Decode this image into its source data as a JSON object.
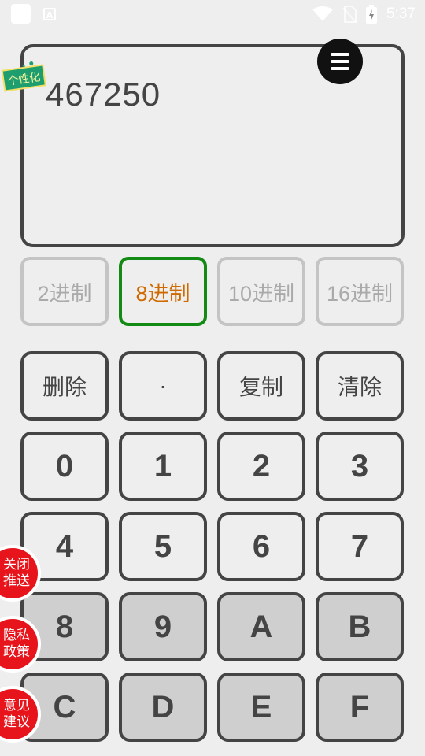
{
  "status_bar": {
    "time": "5:37",
    "icons": [
      "app-square-icon",
      "a-icon",
      "wifi-icon",
      "no-sim-icon",
      "battery-charging-icon"
    ]
  },
  "display": {
    "value": "467250",
    "badge_text": "个性化",
    "menu_icon": "menu-icon"
  },
  "bases": [
    {
      "label": "2进制",
      "active": false
    },
    {
      "label": "8进制",
      "active": true
    },
    {
      "label": "10进制",
      "active": false
    },
    {
      "label": "16进制",
      "active": false
    }
  ],
  "keypad": {
    "row1": [
      "删除",
      "·",
      "复制",
      "清除"
    ],
    "row2": [
      "0",
      "1",
      "2",
      "3"
    ],
    "row3": [
      "4",
      "5",
      "6",
      "7"
    ],
    "row4": [
      "8",
      "9",
      "A",
      "B"
    ],
    "row5": [
      "C",
      "D",
      "E",
      "F"
    ]
  },
  "side_buttons": [
    {
      "line1": "关闭",
      "line2": "推送"
    },
    {
      "line1": "隐私",
      "line2": "政策"
    },
    {
      "line1": "意见",
      "line2": "建议"
    }
  ],
  "colors": {
    "active_tab_border": "#138a13",
    "active_tab_text": "#cf6a00",
    "side_button": "#e8141c"
  }
}
